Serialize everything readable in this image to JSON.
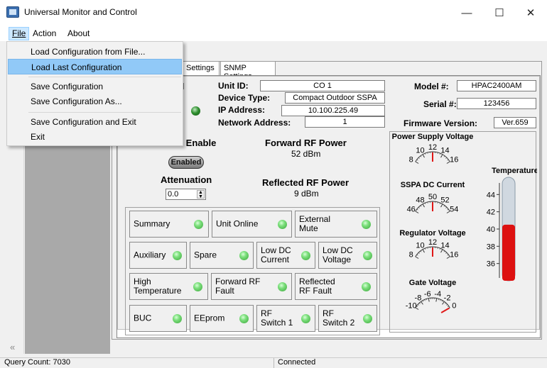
{
  "window": {
    "title": "Universal Monitor and Control",
    "minimize": "—",
    "maximize": "☐",
    "close": "✕"
  },
  "menu": {
    "file": "File",
    "action": "Action",
    "about": "About"
  },
  "file_menu": {
    "load_from_file": "Load Configuration from File...",
    "load_last": "Load Last Configuration",
    "save": "Save Configuration",
    "save_as": "Save Configuration As...",
    "save_exit": "Save Configuration and Exit",
    "exit": "Exit"
  },
  "tabs": {
    "settings": "Settings",
    "snmp": "SNMP Settings"
  },
  "device": {
    "unit_id_label": "Unit ID:",
    "unit_id": "CO 1",
    "device_type_label": "Device Type:",
    "device_type": "Compact Outdoor SSPA",
    "ip_label": "IP Address:",
    "ip": "10.100.225.49",
    "network_label": "Network Address:",
    "network": "1",
    "model_label": "Model #:",
    "model": "HPAC2400AM",
    "serial_label": "Serial #:",
    "serial": "123456",
    "firmware_label": "Firmware Version:",
    "firmware": "Ver.659"
  },
  "controls": {
    "partial_d": "d",
    "enable_label": "r Enable",
    "enabled_button": "Enabled",
    "attenuation_label": "Attenuation",
    "attenuation_value": "0.0",
    "forward_label": "Forward RF Power",
    "forward_value": "52 dBm",
    "reflected_label": "Reflected RF Power",
    "reflected_value": "9 dBm"
  },
  "alarms": [
    {
      "label": "Summary"
    },
    {
      "label": "Unit Online"
    },
    {
      "label": "External Mute"
    },
    {
      "label": "Auxiliary"
    },
    {
      "label": "Spare"
    },
    {
      "label": "Low DC Current"
    },
    {
      "label": "Low DC Voltage"
    },
    {
      "label": "High Temperature"
    },
    {
      "label": "Forward RF Fault"
    },
    {
      "label": "Reflected RF Fault"
    },
    {
      "label": "BUC"
    },
    {
      "label": "EEprom"
    },
    {
      "label": "RF Switch 1"
    },
    {
      "label": "RF Switch 2"
    }
  ],
  "gauges": [
    {
      "title": "Power Supply Voltage",
      "ticks": [
        "8",
        "10",
        "12",
        "14",
        "16"
      ],
      "value": 12,
      "min": 8,
      "max": 16
    },
    {
      "title": "SSPA DC Current",
      "ticks": [
        "46",
        "48",
        "50",
        "52",
        "54"
      ],
      "value": 50,
      "min": 46,
      "max": 54
    },
    {
      "title": "Regulator Voltage",
      "ticks": [
        "8",
        "10",
        "12",
        "14",
        "16"
      ],
      "value": 12,
      "min": 8,
      "max": 16
    },
    {
      "title": "Gate Voltage",
      "ticks": [
        "-10",
        "-8",
        "-6",
        "-4",
        "-2",
        "0"
      ],
      "value": 0,
      "min": -10,
      "max": 0
    }
  ],
  "temperature": {
    "title": "Temperature",
    "ticks": [
      "44",
      "42",
      "40",
      "38",
      "36"
    ],
    "value": 40.5,
    "min": 34,
    "max": 46
  },
  "status": {
    "query_count": "Query Count: 7030",
    "connection": "Connected"
  },
  "colors": {
    "led_green": "#7ee07e",
    "needle_red": "#e01818",
    "thermo_red": "#dd1111",
    "menu_highlight": "#91c9f7"
  }
}
